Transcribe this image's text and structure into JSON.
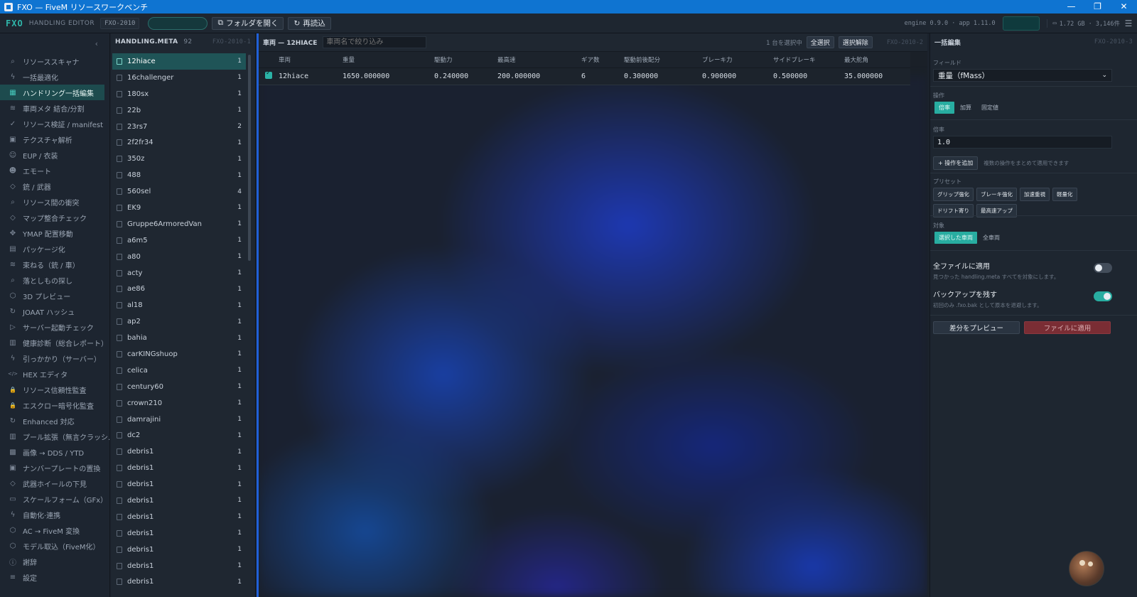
{
  "window": {
    "title": "FXO — FiveM リソースワークベンチ",
    "controls": [
      "—",
      "❐",
      "✕"
    ]
  },
  "toolbar": {
    "brand": "FXO",
    "subtitle": "HANDLING EDITOR",
    "badge": "FXO-2010",
    "open_folder_label": "フォルダを開く",
    "reload_label": "再読込",
    "engine_info": "engine 0.9.0 · app 1.11.0",
    "memory_info": "1.72 GB · 3,146件"
  },
  "sidebar": {
    "items": [
      {
        "label": "リソーススキャナ",
        "icon": "search-icon"
      },
      {
        "label": "一括最適化",
        "icon": "bolt-icon"
      },
      {
        "label": "ハンドリング一括編集",
        "icon": "grid-icon",
        "active": true
      },
      {
        "label": "車両メタ 結合/分割",
        "icon": "layers-icon"
      },
      {
        "label": "リソース検証 / manifest",
        "icon": "check-circle-icon"
      },
      {
        "label": "テクスチャ解析",
        "icon": "image-icon"
      },
      {
        "label": "EUP / 衣装",
        "icon": "person-icon"
      },
      {
        "label": "エモート",
        "icon": "emote-icon"
      },
      {
        "label": "銃 / 武器",
        "icon": "diamond-icon"
      },
      {
        "label": "リソース間の衝突",
        "icon": "search-icon"
      },
      {
        "label": "マップ整合チェック",
        "icon": "diamond-icon"
      },
      {
        "label": "YMAP 配置移動",
        "icon": "move-icon"
      },
      {
        "label": "パッケージ化",
        "icon": "package-icon"
      },
      {
        "label": "束ねる（銃 / 車）",
        "icon": "layers-icon"
      },
      {
        "label": "落としもの探し",
        "icon": "search-icon"
      },
      {
        "label": "3D プレビュー",
        "icon": "cube-icon"
      },
      {
        "label": "JOAAT ハッシュ",
        "icon": "refresh-icon"
      },
      {
        "label": "サーバー起動チェック",
        "icon": "play-icon"
      },
      {
        "label": "健康診断（総合レポート）",
        "icon": "bar-chart-icon"
      },
      {
        "label": "引っかかり（サーバー）",
        "icon": "bolt-icon"
      },
      {
        "label": "HEX エディタ",
        "icon": "code-icon"
      },
      {
        "label": "リソース信頼性監査",
        "icon": "lock-icon"
      },
      {
        "label": "エスクロー暗号化監査",
        "icon": "lock-icon"
      },
      {
        "label": "Enhanced 対応",
        "icon": "refresh-icon"
      },
      {
        "label": "プール拡張（無言クラッシ...",
        "icon": "bar-chart-icon"
      },
      {
        "label": "画像 → DDS / YTD",
        "icon": "checker-icon"
      },
      {
        "label": "ナンバープレートの置換",
        "icon": "image-icon"
      },
      {
        "label": "武器ホイールの下見",
        "icon": "diamond-icon"
      },
      {
        "label": "スケールフォーム（GFx）",
        "icon": "monitor-icon"
      },
      {
        "label": "自動化·連携",
        "icon": "bolt-icon"
      },
      {
        "label": "AC → FiveM 変換",
        "icon": "cube-icon"
      },
      {
        "label": "モデル取込（FiveM化）",
        "icon": "cube-icon"
      },
      {
        "label": "謝辞",
        "icon": "info-icon"
      },
      {
        "label": "設定",
        "icon": "sliders-icon"
      }
    ]
  },
  "filelist": {
    "title": "HANDLING.META",
    "count": "92",
    "code": "FXO-2010-1",
    "files": [
      {
        "name": "12hiace",
        "count": "1",
        "active": true
      },
      {
        "name": "16challenger",
        "count": "1"
      },
      {
        "name": "180sx",
        "count": "1"
      },
      {
        "name": "22b",
        "count": "1"
      },
      {
        "name": "23rs7",
        "count": "2"
      },
      {
        "name": "2f2fr34",
        "count": "1"
      },
      {
        "name": "350z",
        "count": "1"
      },
      {
        "name": "488",
        "count": "1"
      },
      {
        "name": "560sel",
        "count": "4"
      },
      {
        "name": "EK9",
        "count": "1"
      },
      {
        "name": "Gruppe6ArmoredVan",
        "count": "1"
      },
      {
        "name": "a6m5",
        "count": "1"
      },
      {
        "name": "a80",
        "count": "1"
      },
      {
        "name": "acty",
        "count": "1"
      },
      {
        "name": "ae86",
        "count": "1"
      },
      {
        "name": "al18",
        "count": "1"
      },
      {
        "name": "ap2",
        "count": "1"
      },
      {
        "name": "bahia",
        "count": "1"
      },
      {
        "name": "carKINGshuop",
        "count": "1"
      },
      {
        "name": "celica",
        "count": "1"
      },
      {
        "name": "century60",
        "count": "1"
      },
      {
        "name": "crown210",
        "count": "1"
      },
      {
        "name": "damrajini",
        "count": "1"
      },
      {
        "name": "dc2",
        "count": "1"
      },
      {
        "name": "debris1",
        "count": "1"
      },
      {
        "name": "debris1",
        "count": "1"
      },
      {
        "name": "debris1",
        "count": "1"
      },
      {
        "name": "debris1",
        "count": "1"
      },
      {
        "name": "debris1",
        "count": "1"
      },
      {
        "name": "debris1",
        "count": "1"
      },
      {
        "name": "debris1",
        "count": "1"
      },
      {
        "name": "debris1",
        "count": "1"
      },
      {
        "name": "debris1",
        "count": "1"
      }
    ]
  },
  "main": {
    "title": "車両 — 12HIACE",
    "search_placeholder": "車両名で絞り込み",
    "selection_info": "1 台を選択中",
    "select_all": "全選択",
    "deselect": "選択解除",
    "code": "FXO-2010-2",
    "columns": [
      "車両",
      "重量",
      "駆動力",
      "最高速",
      "ギア数",
      "駆動前後配分",
      "ブレーキ力",
      "サイドブレーキ",
      "最大舵角"
    ],
    "rows": [
      {
        "checked": true,
        "cells": [
          "12hiace",
          "1650.000000",
          "0.240000",
          "200.000000",
          "6",
          "0.300000",
          "0.900000",
          "0.500000",
          "35.000000"
        ]
      }
    ]
  },
  "rpanel": {
    "title": "一括編集",
    "code": "FXO-2010-3",
    "field_label": "フィールド",
    "field_value": "重量（fMass）",
    "op_label": "操作",
    "ops": [
      {
        "label": "倍率",
        "on": true
      },
      {
        "label": "加算",
        "on": false
      },
      {
        "label": "固定値",
        "on": false
      }
    ],
    "factor_label": "倍率",
    "factor_value": "1.0",
    "add_op_label": "+ 操作を追加",
    "add_op_hint": "複数の操作をまとめて適用できます",
    "preset_label": "プリセット",
    "presets": [
      "グリップ強化",
      "ブレーキ強化",
      "加速重視",
      "軽量化",
      "ドリフト寄り",
      "最高速アップ"
    ],
    "target_label": "対象",
    "targets": [
      {
        "label": "選択した車両",
        "on": true
      },
      {
        "label": "全車両",
        "on": false
      }
    ],
    "all_files_title": "全ファイルに適用",
    "all_files_desc": "見つかった handling.meta すべてを対象にします。",
    "all_files_on": false,
    "backup_title": "バックアップを残す",
    "backup_desc": "初回のみ .fxo.bak として原本を退避します。",
    "backup_on": true,
    "preview_label": "差分をプレビュー",
    "apply_label": "ファイルに適用"
  },
  "colors": {
    "accent": "#28ada1",
    "titlebar": "#0f74d1",
    "danger": "#7a2d34"
  }
}
